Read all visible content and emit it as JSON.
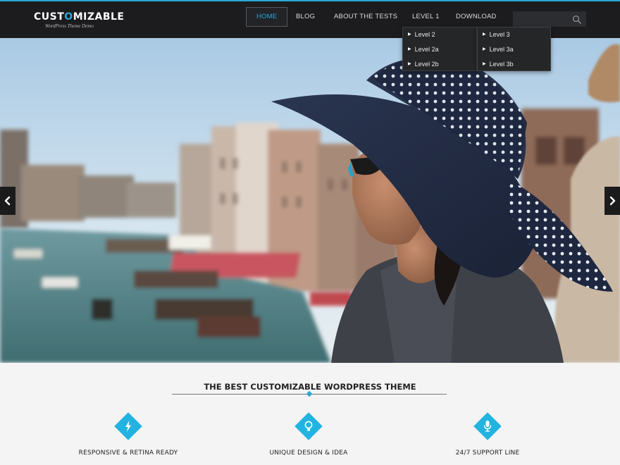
{
  "header": {
    "logo_title_start": "CUST",
    "logo_title_accent": "O",
    "logo_title_end": "MIZABLE",
    "logo_subtitle": "WordPress Theme Demo",
    "nav": [
      {
        "label": "HOME",
        "active": true
      },
      {
        "label": "BLOG",
        "active": false
      },
      {
        "label": "ABOUT THE TESTS",
        "active": false
      },
      {
        "label": "LEVEL 1",
        "active": false
      },
      {
        "label": "DOWNLOAD",
        "active": false
      }
    ],
    "search": {
      "value": "",
      "placeholder": ""
    },
    "dropdown_level1": [
      "Level 2",
      "Level 2a",
      "Level 2b"
    ],
    "dropdown_level2": [
      "Level 3",
      "Level 3a",
      "Level 3b"
    ]
  },
  "features": {
    "title": "THE BEST CUSTOMIZABLE WORDPRESS THEME",
    "items": [
      {
        "label": "RESPONSIVE & RETINA READY",
        "icon": "lightning-icon"
      },
      {
        "label": "UNIQUE DESIGN & IDEA",
        "icon": "lightbulb-icon"
      },
      {
        "label": "24/7 SUPPORT LINE",
        "icon": "microphone-icon"
      }
    ]
  },
  "colors": {
    "accent": "#2aa7d8",
    "header_bg": "#1c1c1e",
    "diamond": "#23b3e0"
  }
}
